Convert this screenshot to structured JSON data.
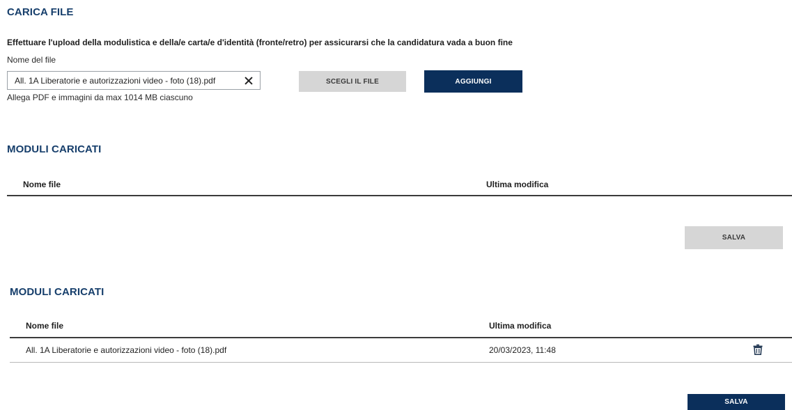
{
  "upload": {
    "title": "CARICA FILE",
    "instructions": "Effettuare l'upload della modulistica e della/e carta/e d'identità (fronte/retro) per assicurarsi che la candidatura vada a buon fine",
    "field_label": "Nome del file",
    "file_value": "All. 1A Liberatorie e autorizzazioni video - foto (18).pdf",
    "hint": "Allega PDF e immagini da max 1014 MB ciascuno",
    "choose_label": "SCEGLI IL FILE",
    "add_label": "AGGIUNGI"
  },
  "section_empty": {
    "title": "MODULI CARICATI",
    "col_name": "Nome file",
    "col_modified": "Ultima modifica",
    "save_label": "SALVA"
  },
  "section_filled": {
    "title": "MODULI CARICATI",
    "col_name": "Nome file",
    "col_modified": "Ultima modifica",
    "rows": [
      {
        "name": "All. 1A Liberatorie e autorizzazioni video - foto (18).pdf",
        "modified": "20/03/2023, 11:48"
      }
    ],
    "save_label": "SALVA"
  },
  "icons": {
    "clear": "close-icon",
    "delete": "trash-icon"
  },
  "colors": {
    "heading": "#163e6b",
    "primary": "#0b2f5b",
    "disabled": "#d6d6d6"
  }
}
